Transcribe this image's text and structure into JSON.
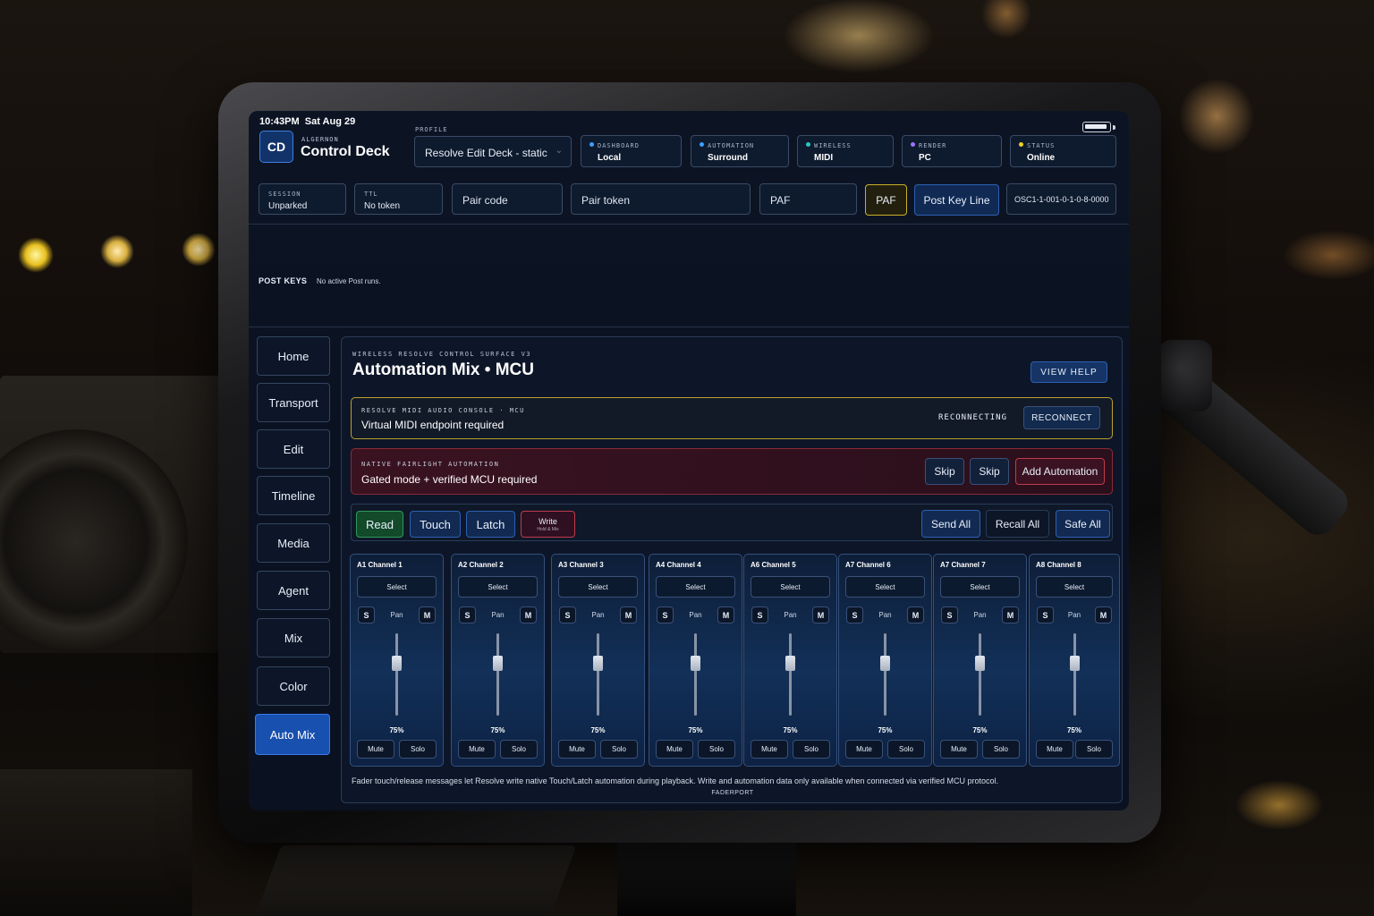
{
  "status_bar": {
    "time": "10:43PM",
    "date": "Sat Aug 29"
  },
  "app": {
    "logo": "CD",
    "kicker": "ALGERNON",
    "title": "Control Deck"
  },
  "profile": {
    "label": "PROFILE",
    "value": "Resolve Edit Deck - static"
  },
  "status_pills": [
    {
      "key": "DASHBOARD",
      "value": "Local",
      "dot_color": "#3aa0ff"
    },
    {
      "key": "AUTOMATION",
      "value": "Surround",
      "dot_color": "#3aa0ff"
    },
    {
      "key": "WIRELESS",
      "value": "MIDI",
      "dot_color": "#2cc6c0"
    },
    {
      "key": "RENDER",
      "value": "PC",
      "dot_color": "#a070ff"
    },
    {
      "key": "STATUS",
      "value": "Online",
      "dot_color": "#f0d020"
    }
  ],
  "session": {
    "label": "SESSION",
    "value": "Unparked"
  },
  "ttl": {
    "label": "TTL",
    "value": "No token"
  },
  "pair_code": {
    "placeholder": "Pair code"
  },
  "pair_token": {
    "placeholder": "Pair token"
  },
  "paf_field": {
    "value": "PAF"
  },
  "paf_button": {
    "label": "PAF",
    "accent": "#c8b02a"
  },
  "post_key_line_button": {
    "label": "Post Key Line"
  },
  "osc_id": {
    "value": "OSC1-1-001-0-1-0-8-0000"
  },
  "post_keys": {
    "label": "POST KEYS",
    "message": "No active Post runs."
  },
  "sidebar": {
    "items": [
      {
        "label": "Home",
        "active": false
      },
      {
        "label": "Transport",
        "active": false
      },
      {
        "label": "Edit",
        "active": false
      },
      {
        "label": "Timeline",
        "active": false
      },
      {
        "label": "Media",
        "active": false
      },
      {
        "label": "Agent",
        "active": false
      },
      {
        "label": "Mix",
        "active": false
      },
      {
        "label": "Color",
        "active": false
      },
      {
        "label": "Auto Mix",
        "active": true
      }
    ]
  },
  "panel": {
    "kicker": "WIRELESS RESOLVE CONTROL SURFACE V3",
    "title": "Automation Mix • MCU",
    "help_label": "VIEW HELP"
  },
  "midi_banner": {
    "kicker": "RESOLVE MIDI AUDIO CONSOLE · MCU",
    "message": "Virtual MIDI endpoint required",
    "state": "RECONNECTING",
    "button": "RECONNECT",
    "accent": "#b8a230"
  },
  "fairlight_banner": {
    "kicker": "NATIVE FAIRLIGHT AUTOMATION",
    "message": "Gated mode + verified MCU required",
    "skip1": "Skip",
    "skip2": "Skip",
    "add_button": "Add Automation",
    "accent": "#8a2a38"
  },
  "modes": {
    "read": "Read",
    "touch": "Touch",
    "latch": "Latch",
    "write": "Write",
    "write_sub": "Hold & Mix",
    "send_all": "Send All",
    "recall_all": "Recall All",
    "safe_all": "Safe All"
  },
  "channels": [
    {
      "name": "A1  Channel 1",
      "select": "Select",
      "s": "S",
      "pan": "Pan",
      "m": "M",
      "level": "75%",
      "level_value": 0.75,
      "mute": "Mute",
      "solo": "Solo"
    },
    {
      "name": "A2  Channel 2",
      "select": "Select",
      "s": "S",
      "pan": "Pan",
      "m": "M",
      "level": "75%",
      "level_value": 0.75,
      "mute": "Mute",
      "solo": "Solo"
    },
    {
      "name": "A3  Channel 3",
      "select": "Select",
      "s": "S",
      "pan": "Pan",
      "m": "M",
      "level": "75%",
      "level_value": 0.75,
      "mute": "Mute",
      "solo": "Solo"
    },
    {
      "name": "A4  Channel 4",
      "select": "Select",
      "s": "S",
      "pan": "Pan",
      "m": "M",
      "level": "75%",
      "level_value": 0.75,
      "mute": "Mute",
      "solo": "Solo"
    },
    {
      "name": "A6  Channel 5",
      "select": "Select",
      "s": "S",
      "pan": "Pan",
      "m": "M",
      "level": "75%",
      "level_value": 0.75,
      "mute": "Mute",
      "solo": "Solo"
    },
    {
      "name": "A7  Channel 6",
      "select": "Select",
      "s": "S",
      "pan": "Pan",
      "m": "M",
      "level": "75%",
      "level_value": 0.75,
      "mute": "Mute",
      "solo": "Solo"
    },
    {
      "name": "A7  Channel 7",
      "select": "Select",
      "s": "S",
      "pan": "Pan",
      "m": "M",
      "level": "75%",
      "level_value": 0.75,
      "mute": "Mute",
      "solo": "Solo"
    },
    {
      "name": "A8  Channel 8",
      "select": "Select",
      "s": "S",
      "pan": "Pan",
      "m": "M",
      "level": "75%",
      "level_value": 0.75,
      "mute": "Mute",
      "solo": "Solo"
    }
  ],
  "footer": {
    "note": "Fader touch/release messages let Resolve write native Touch/Latch automation during playback. Write and automation data only available when connected via verified MCU protocol.",
    "label": "FADERPORT"
  }
}
